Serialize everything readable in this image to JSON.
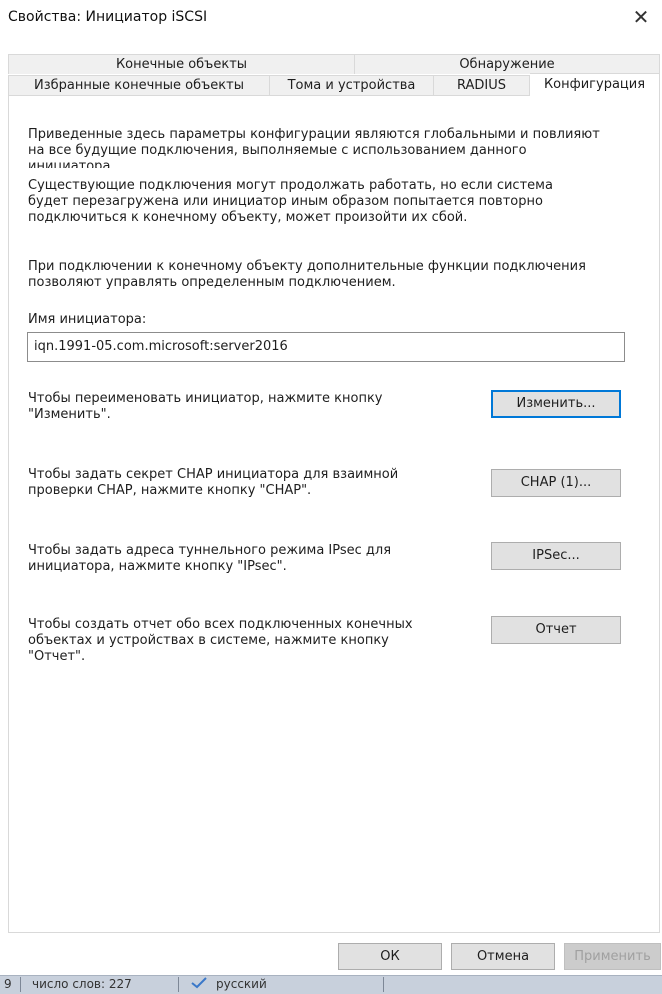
{
  "window": {
    "title": "Свойства: Инициатор iSCSI",
    "close_glyph": "✕"
  },
  "tabs": {
    "row1": [
      "Конечные объекты",
      "Обнаружение"
    ],
    "row2": [
      "Избранные конечные объекты",
      "Тома и устройства",
      "RADIUS",
      "Конфигурация"
    ],
    "active": "Конфигурация"
  },
  "config": {
    "intro_line1": "Приведенные здесь параметры конфигурации являются глобальными и повлияют",
    "intro_line2": "на все будущие подключения, выполняемые с использованием данного",
    "intro_line3": "инициатора.",
    "existing_line1": "Существующие подключения могут продолжать работать, но если система",
    "existing_line2": "будет перезагружена или инициатор иным образом попытается повторно",
    "existing_line3": "подключиться к конечному объекту, может произойти их сбой.",
    "features_line1": "При подключении к конечному объекту дополнительные функции подключения",
    "features_line2": "позволяют управлять определенным подключением.",
    "initiator_label": "Имя инициатора:",
    "initiator_value": "iqn.1991-05.com.microsoft:server2016",
    "rename_line1": "Чтобы переименовать инициатор, нажмите кнопку",
    "rename_line2": "\"Изменить\".",
    "rename_button": "Изменить...",
    "chap_line1": "Чтобы задать секрет CHAP инициатора для взаимной",
    "chap_line2": "проверки CHAP, нажмите кнопку \"CHAP\".",
    "chap_button": "CHAP (1)...",
    "ipsec_line1": "Чтобы задать адреса туннельного режима IPsec для",
    "ipsec_line2": "инициатора, нажмите кнопку \"IPsec\".",
    "ipsec_button": "IPSec...",
    "report_line1": "Чтобы создать отчет обо всех подключенных конечных",
    "report_line2": "объектах и устройствах в системе, нажмите кнопку",
    "report_line3": "\"Отчет\".",
    "report_button": "Отчет"
  },
  "footer": {
    "ok": "ОК",
    "cancel": "Отмена",
    "apply": "Применить"
  },
  "statusbar": {
    "page": "9",
    "words": "число слов: 227",
    "language": "русский"
  }
}
